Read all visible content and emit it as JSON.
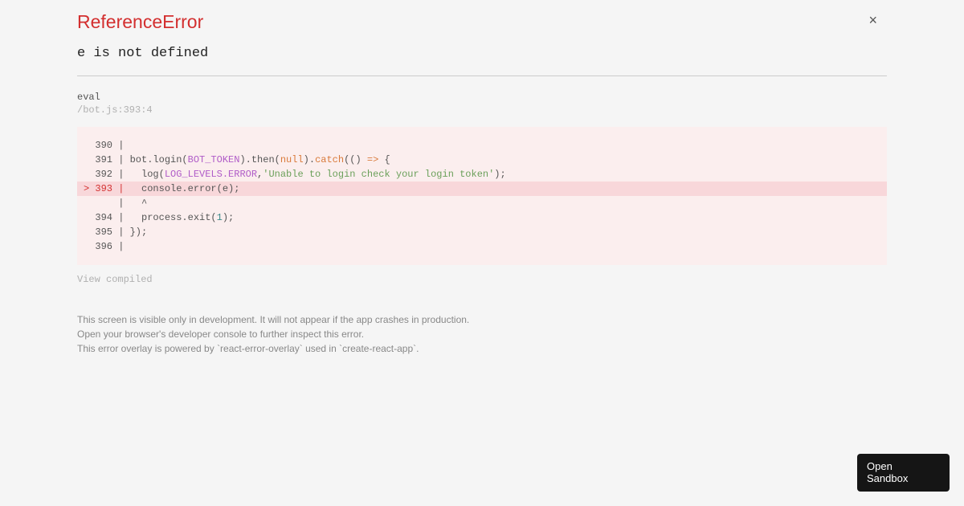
{
  "error": {
    "title": "ReferenceError",
    "message": "e is not defined"
  },
  "stack": {
    "func": "eval",
    "location": "/bot.js:393:4",
    "view_compiled": "View compiled"
  },
  "code": {
    "l390_num": "  390 | ",
    "l391_num": "  391 | ",
    "l391_a": "bot.login(",
    "l391_token_const": "BOT_TOKEN",
    "l391_b": ").then(",
    "l391_null": "null",
    "l391_c": ").",
    "l391_catch": "catch",
    "l391_d": "(() ",
    "l391_arrow": "=>",
    "l391_e": " {",
    "l392_num": "  392 |   ",
    "l392_a": "log(",
    "l392_const": "LOG_LEVELS.ERROR",
    "l392_b": ",",
    "l392_str": "'Unable to login check your login token'",
    "l392_c": ");",
    "l393_prefix": "> 393 |   ",
    "l393_body": "console.error(e);",
    "l394_caret": "      |   ^",
    "l394_num": "  394 |   ",
    "l394_a": "process.exit(",
    "l394_one": "1",
    "l394_b": ");",
    "l395": "  395 | });",
    "l396": "  396 | "
  },
  "footer": {
    "line1": "This screen is visible only in development. It will not appear if the app crashes in production.",
    "line2": "Open your browser's developer console to further inspect this error.",
    "line3": "This error overlay is powered by `react-error-overlay` used in `create-react-app`."
  },
  "buttons": {
    "close": "×",
    "sandbox_l1": "Open",
    "sandbox_l2": "Sandbox"
  }
}
